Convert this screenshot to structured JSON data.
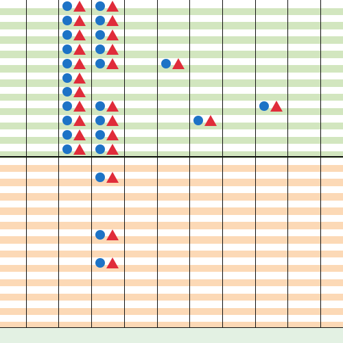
{
  "palette": {
    "green_band": "#d2e6bf",
    "orange_band": "#fcd9b6",
    "grid_line": "#111111",
    "bottom_bar": "#e3f1e3",
    "circle": "#1d73c6",
    "triangle": "#e02c3a"
  },
  "board": {
    "columns": 10,
    "upper_section": {
      "color": "green",
      "rows": 11
    },
    "lower_section": {
      "color": "orange",
      "rows": 12
    },
    "pieces": [
      {
        "col": 2,
        "row": 0,
        "section": "upper",
        "icon_pair": "circle-triangle"
      },
      {
        "col": 2,
        "row": 1,
        "section": "upper",
        "icon_pair": "circle-triangle"
      },
      {
        "col": 2,
        "row": 2,
        "section": "upper",
        "icon_pair": "circle-triangle"
      },
      {
        "col": 2,
        "row": 3,
        "section": "upper",
        "icon_pair": "circle-triangle"
      },
      {
        "col": 2,
        "row": 4,
        "section": "upper",
        "icon_pair": "circle-triangle"
      },
      {
        "col": 2,
        "row": 5,
        "section": "upper",
        "icon_pair": "circle-triangle"
      },
      {
        "col": 2,
        "row": 6,
        "section": "upper",
        "icon_pair": "circle-triangle"
      },
      {
        "col": 2,
        "row": 7,
        "section": "upper",
        "icon_pair": "circle-triangle"
      },
      {
        "col": 2,
        "row": 8,
        "section": "upper",
        "icon_pair": "circle-triangle"
      },
      {
        "col": 2,
        "row": 9,
        "section": "upper",
        "icon_pair": "circle-triangle"
      },
      {
        "col": 2,
        "row": 10,
        "section": "upper",
        "icon_pair": "circle-triangle"
      },
      {
        "col": 3,
        "row": 0,
        "section": "upper",
        "icon_pair": "circle-triangle"
      },
      {
        "col": 3,
        "row": 1,
        "section": "upper",
        "icon_pair": "circle-triangle"
      },
      {
        "col": 3,
        "row": 2,
        "section": "upper",
        "icon_pair": "circle-triangle"
      },
      {
        "col": 3,
        "row": 3,
        "section": "upper",
        "icon_pair": "circle-triangle"
      },
      {
        "col": 3,
        "row": 4,
        "section": "upper",
        "icon_pair": "circle-triangle"
      },
      {
        "col": 3,
        "row": 7,
        "section": "upper",
        "icon_pair": "circle-triangle"
      },
      {
        "col": 3,
        "row": 8,
        "section": "upper",
        "icon_pair": "circle-triangle"
      },
      {
        "col": 3,
        "row": 9,
        "section": "upper",
        "icon_pair": "circle-triangle"
      },
      {
        "col": 3,
        "row": 10,
        "section": "upper",
        "icon_pair": "circle-triangle"
      },
      {
        "col": 5,
        "row": 4,
        "section": "upper",
        "icon_pair": "circle-triangle"
      },
      {
        "col": 6,
        "row": 8,
        "section": "upper",
        "icon_pair": "circle-triangle"
      },
      {
        "col": 8,
        "row": 7,
        "section": "upper",
        "icon_pair": "circle-triangle"
      },
      {
        "col": 3,
        "row": 1,
        "section": "lower",
        "icon_pair": "circle-triangle"
      },
      {
        "col": 3,
        "row": 5,
        "section": "lower",
        "icon_pair": "circle-triangle"
      },
      {
        "col": 3,
        "row": 7,
        "section": "lower",
        "icon_pair": "circle-triangle"
      }
    ]
  }
}
